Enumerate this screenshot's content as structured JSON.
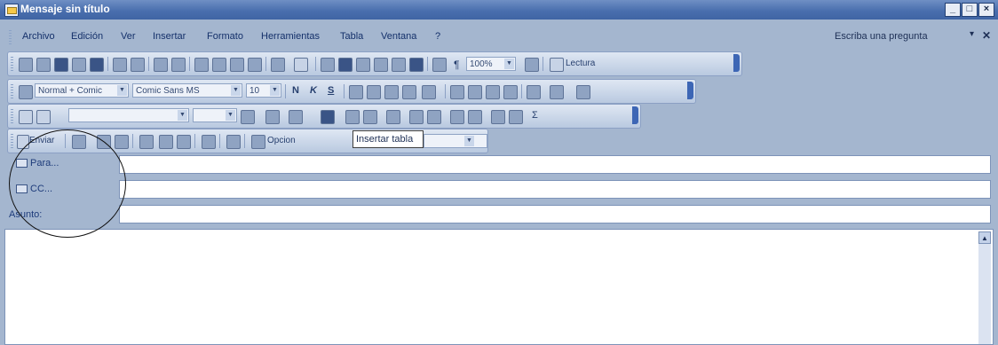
{
  "window": {
    "title": "Mensaje sin título",
    "buttons": [
      "_",
      "□",
      "×"
    ]
  },
  "menu": {
    "items": [
      "Archivo",
      "Edición",
      "Ver",
      "Insertar",
      "Formato",
      "Herramientas",
      "Tabla",
      "Ventana",
      "?"
    ],
    "help_placeholder": "Escriba una pregunta"
  },
  "toolbar_standard": {
    "zoom": "100%",
    "reading": "Lectura"
  },
  "toolbar_format": {
    "style": "Normal + Comic",
    "font": "Comic Sans MS",
    "size": "10",
    "bold": "N",
    "italic": "K",
    "underline": "S"
  },
  "toolbar_mail": {
    "send": "Enviar",
    "options": "Opcion",
    "tooltip": "Insertar tabla"
  },
  "fields": {
    "to_label": "Para...",
    "cc_label": "CC...",
    "subject_label": "Asunto:"
  }
}
